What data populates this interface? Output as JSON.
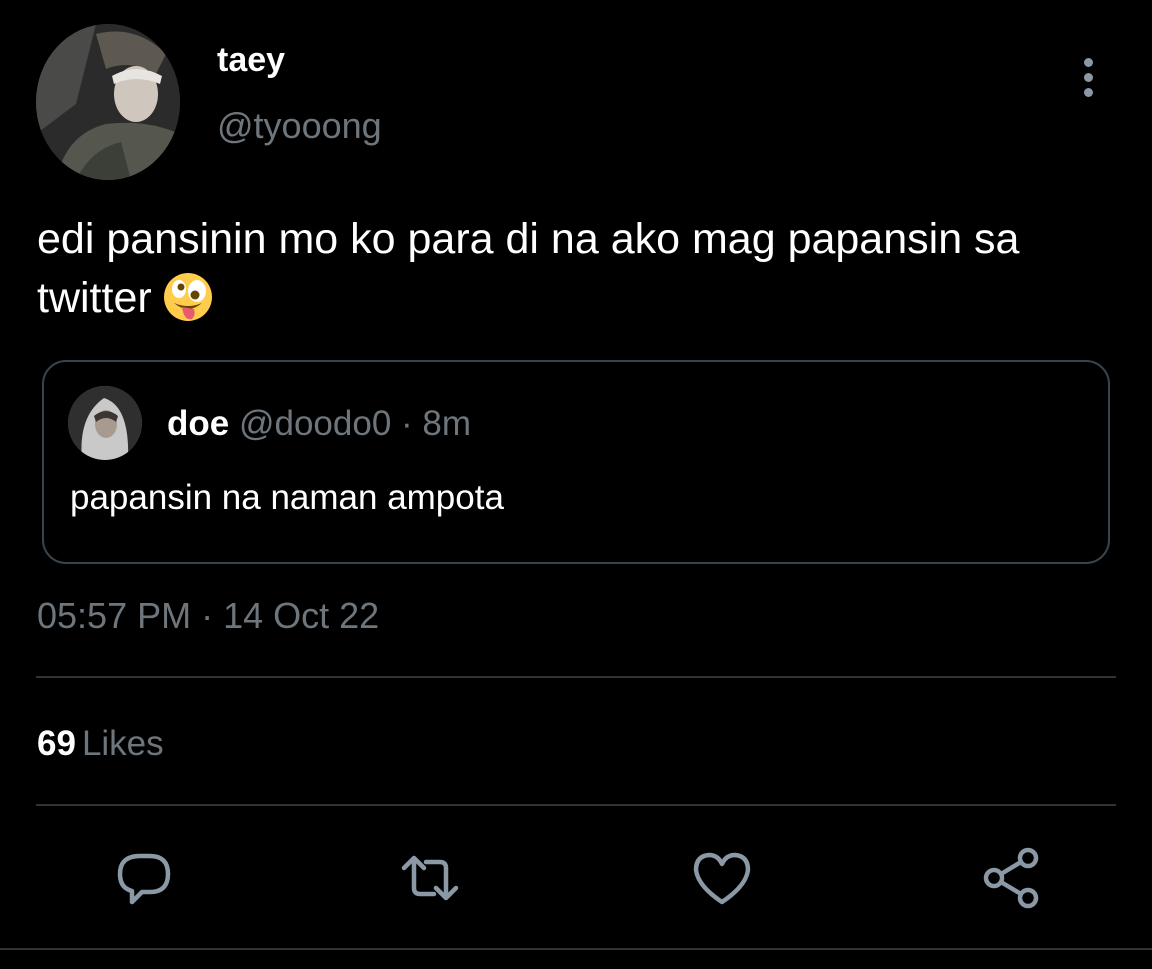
{
  "tweet": {
    "author": {
      "name": "taey",
      "handle": "@tyooong",
      "avatar": "profile-photo-person-in-cap"
    },
    "text": "edi pansinin mo ko para di na ako mag papansin sa twitter",
    "emoji": "zany-face-emoji",
    "quote": {
      "name": "doe",
      "handle": "@doodo0",
      "separator": "·",
      "age": "8m",
      "text": "papansin na naman ampota",
      "avatar": "profile-photo-person-in-hood"
    },
    "timestamp": "05:57 PM · 14 Oct 22",
    "likes": {
      "count": "69",
      "label": "Likes"
    }
  },
  "actions": {
    "reply": "reply-icon",
    "retweet": "retweet-icon",
    "like": "heart-icon",
    "share": "share-icon",
    "more": "more-options-icon"
  },
  "colors": {
    "background": "#000000",
    "primary_text": "#ffffff",
    "secondary_text": "#6e767d",
    "border": "#38444d",
    "icon": "#8b98a5"
  }
}
